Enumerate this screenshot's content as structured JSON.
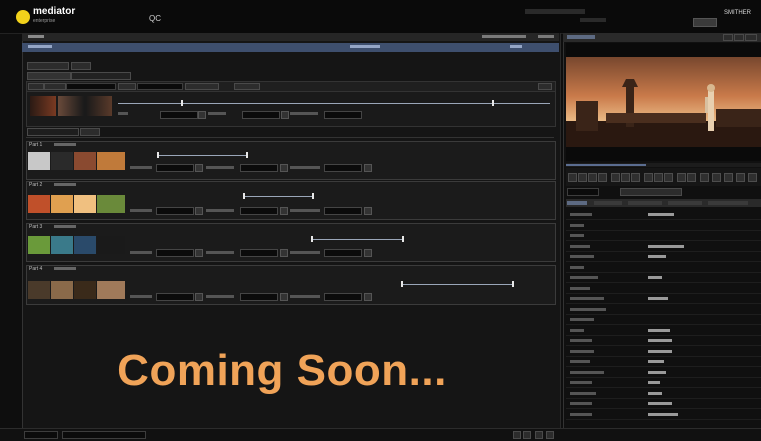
{
  "app": {
    "logo_name": "mediator",
    "logo_sub": "enterprise",
    "title": "QC",
    "user": "SMITHER"
  },
  "parts": [
    {
      "label": "Part 1",
      "thumb_colors": [
        "#6a6a6a",
        "#2a2a2a",
        "#8a4a30",
        "#c07a3a"
      ]
    },
    {
      "label": "Part 2",
      "thumb_colors": [
        "#c0502a",
        "#e0a050",
        "#f0c080",
        "#6a8a3a"
      ]
    },
    {
      "label": "Part 3",
      "thumb_colors": [
        "#6a9a3a",
        "#3a7a8a",
        "#2a4a6a",
        "#1a1a1a"
      ]
    },
    {
      "label": "Part 4",
      "thumb_colors": [
        "#4a3a2a",
        "#8a6a4a",
        "#3a2a1a",
        "#a07a5a"
      ]
    }
  ],
  "overlay": {
    "message": "Coming Soon..."
  },
  "colors": {
    "accent_title_bar": "#3e4f6e",
    "overlay_text": "#f0a358",
    "logo": "#f2d21b"
  },
  "icons": [
    "logo-dot-icon",
    "play-icon",
    "stop-icon",
    "rewind-icon",
    "forward-icon"
  ]
}
